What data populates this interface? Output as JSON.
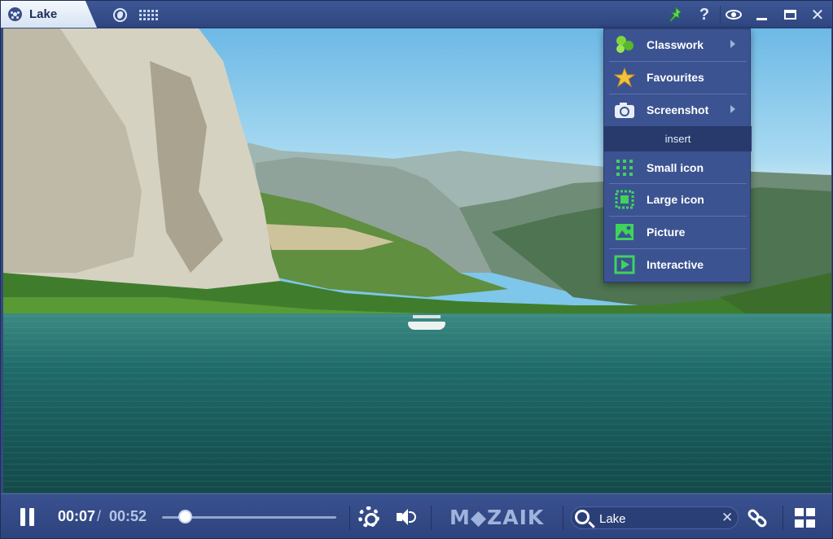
{
  "window": {
    "tab_title": "Lake"
  },
  "menu": {
    "items": [
      {
        "label": "Classwork",
        "icon": "classwork-icon",
        "submenu": true
      },
      {
        "label": "Favourites",
        "icon": "star-icon",
        "submenu": false
      },
      {
        "label": "Screenshot",
        "icon": "camera-icon",
        "submenu": true
      }
    ],
    "section_header": "insert",
    "insert_items": [
      {
        "label": "Small icon",
        "icon": "small-icon-grid-icon"
      },
      {
        "label": "Large icon",
        "icon": "large-icon-frame-icon"
      },
      {
        "label": "Picture",
        "icon": "picture-icon"
      },
      {
        "label": "Interactive",
        "icon": "interactive-play-icon"
      }
    ]
  },
  "player": {
    "current_time": "00:07",
    "separator": "/",
    "total_time": "00:52",
    "progress_fraction": 0.135,
    "brand": "M◆ZAIK"
  },
  "search": {
    "value": "Lake"
  },
  "colors": {
    "accent_green": "#3fd35a",
    "bar_blue": "#34497f",
    "menu_blue": "#3c5392"
  }
}
